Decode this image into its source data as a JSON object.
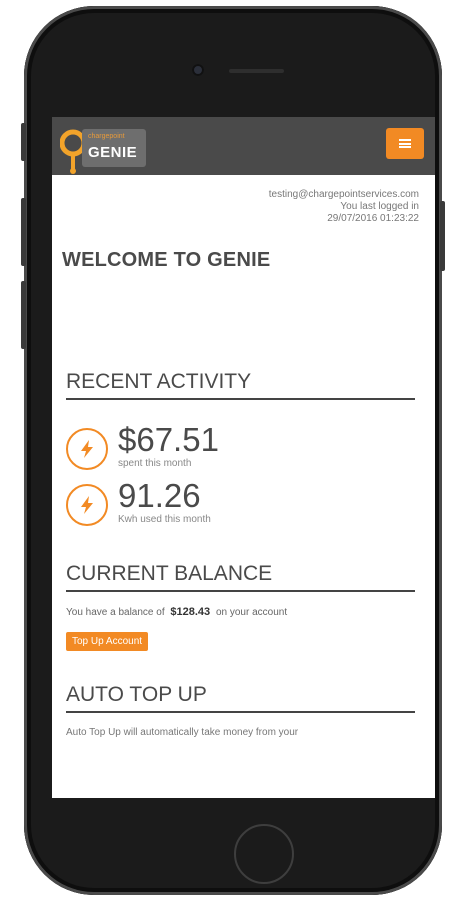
{
  "header": {
    "logo_small": "chargepoint",
    "logo_text": "GENIE",
    "menu_icon": "hamburger-icon",
    "accent_color": "#f28a24"
  },
  "user": {
    "email": "testing@chargepointservices.com",
    "last_login_label": "You last logged in",
    "last_login_time": "29/07/2016 01:23:22"
  },
  "welcome_title": "WELCOME TO GENIE",
  "recent_activity": {
    "title": "RECENT ACTIVITY",
    "stats": [
      {
        "icon": "lightning-icon",
        "value": "$67.51",
        "label": "spent this month"
      },
      {
        "icon": "lightning-icon",
        "value": "91.26",
        "label": "Kwh used this month"
      }
    ]
  },
  "current_balance": {
    "title": "CURRENT BALANCE",
    "prefix": "You have a balance of",
    "amount": "$128.43",
    "suffix": "on your account",
    "button_label": "Top Up Account"
  },
  "auto_top_up": {
    "title": "AUTO TOP UP",
    "description": "Auto Top Up will automatically take money from your"
  }
}
